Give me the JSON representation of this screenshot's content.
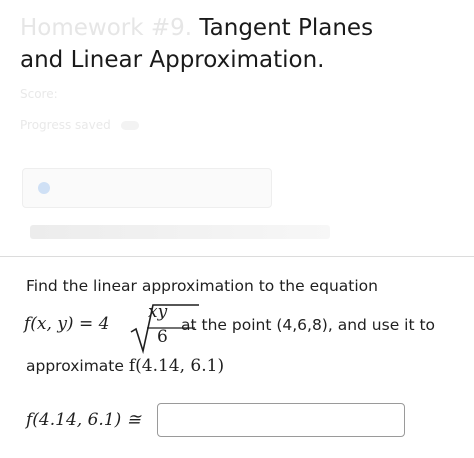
{
  "header": {
    "title_faded": "Homework #9.",
    "title_line1": " Tangent Planes",
    "title_line2": "and Linear Approximation."
  },
  "meta": {
    "score_text": "Score: ",
    "progress_text": "Progress saved"
  },
  "question": {
    "intro": "Find the linear approximation to the equation",
    "fx": "f(x, y) = 4",
    "frac_numerator": "xy",
    "frac_denominator": "6",
    "point_text": "at the point (4,6,8), and use it to",
    "approx_prefix": "approximate ",
    "approx_math": "f(4.14, 6.1)",
    "answer_label": "f(4.14, 6.1) ≅",
    "answer_value": ""
  }
}
